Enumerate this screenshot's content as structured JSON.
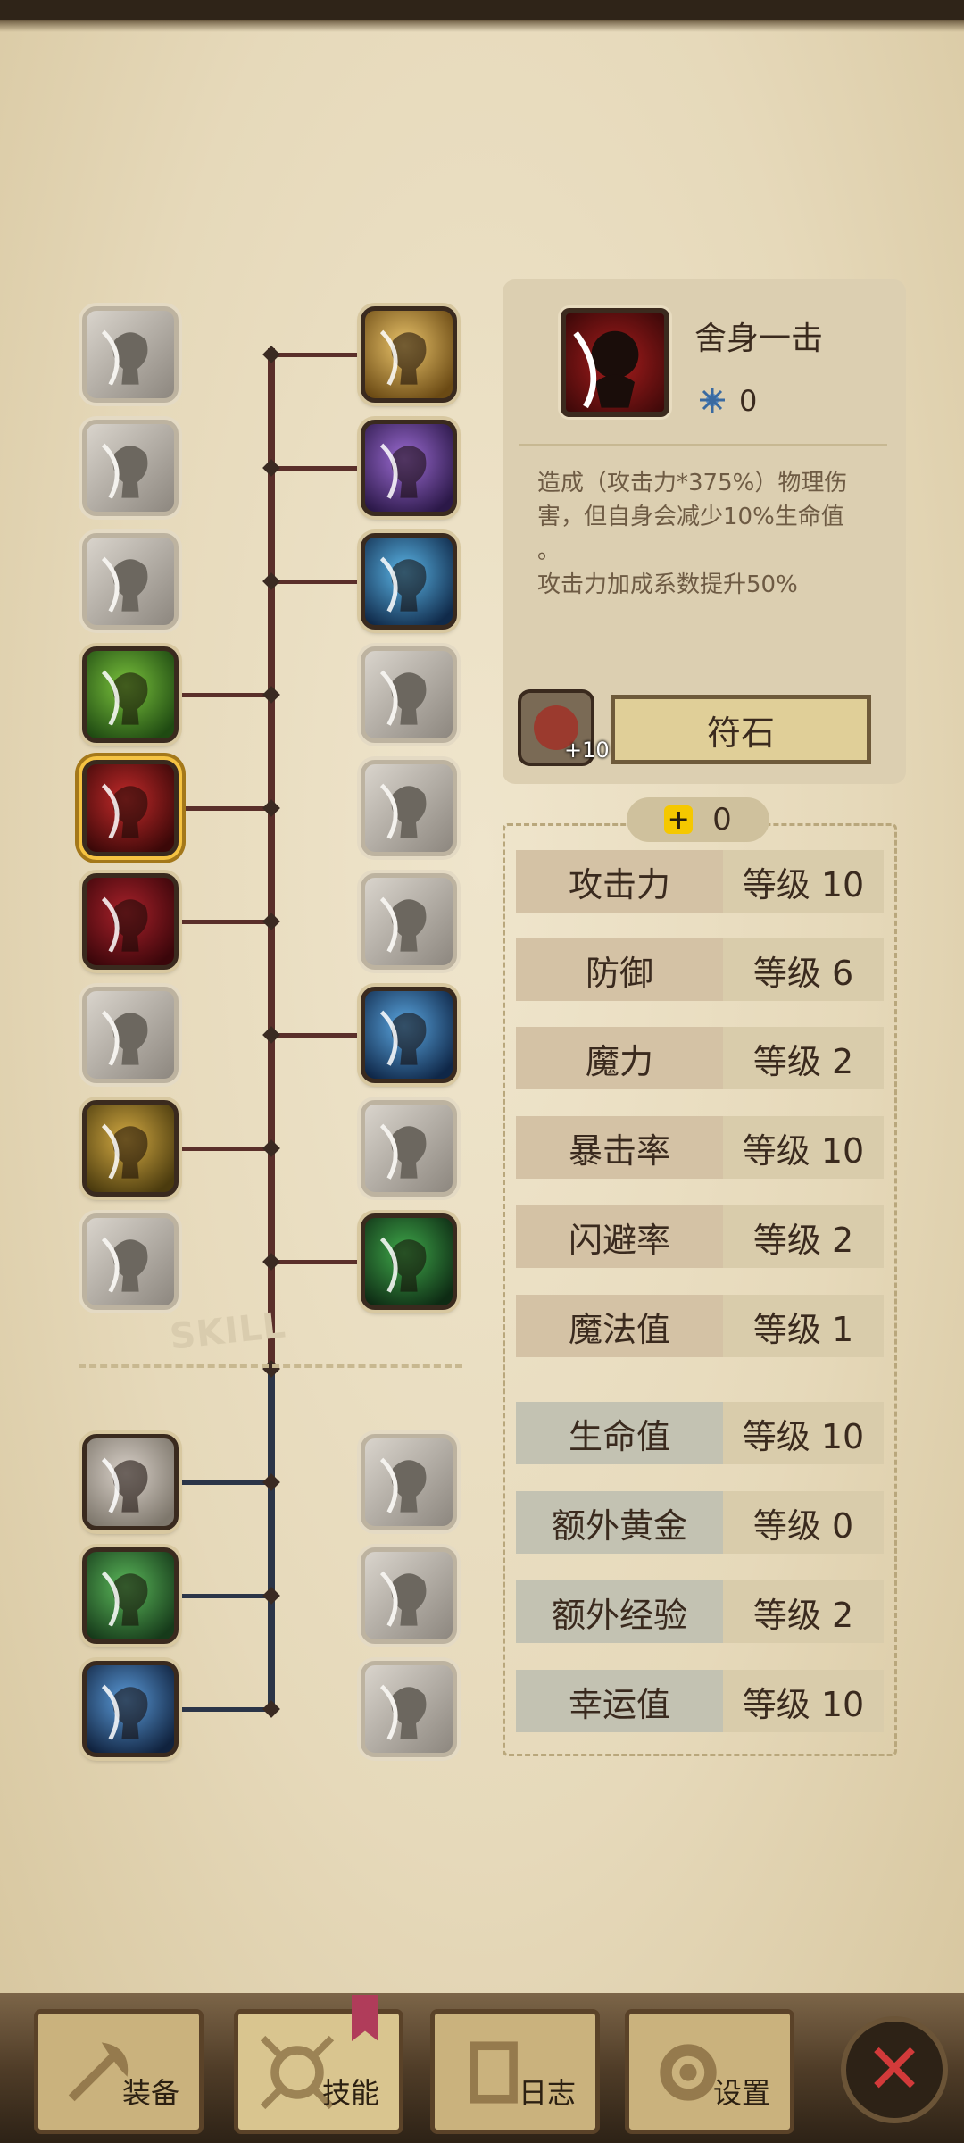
{
  "skill_tree": {
    "section_label": "SKILL",
    "left_skills": [
      {
        "id": "skill-slash",
        "state": "locked",
        "icon": "slash-icon"
      },
      {
        "id": "skill-kick",
        "state": "locked",
        "icon": "kick-icon"
      },
      {
        "id": "skill-roar",
        "state": "locked",
        "icon": "roar-icon"
      },
      {
        "id": "skill-muscle",
        "state": "unlocked",
        "icon": "muscle-arm-icon"
      },
      {
        "id": "skill-sacrifice-strike",
        "state": "selected",
        "icon": "sacrifice-strike-icon"
      },
      {
        "id": "skill-dagger",
        "state": "unlocked",
        "icon": "dagger-icon"
      },
      {
        "id": "skill-dash",
        "state": "locked",
        "icon": "dash-icon"
      },
      {
        "id": "skill-golden-fury",
        "state": "unlocked",
        "icon": "golden-fury-icon"
      },
      {
        "id": "skill-crossed-swords",
        "state": "locked",
        "icon": "crossed-swords-icon"
      }
    ],
    "right_skills": [
      {
        "id": "skill-holy-shield",
        "state": "unlocked",
        "icon": "holy-shield-icon"
      },
      {
        "id": "skill-shadow-ghost",
        "state": "unlocked",
        "icon": "shadow-ghost-icon"
      },
      {
        "id": "skill-lightning",
        "state": "unlocked",
        "icon": "lightning-icon"
      },
      {
        "id": "skill-run",
        "state": "locked",
        "icon": "run-icon"
      },
      {
        "id": "skill-smoke",
        "state": "locked",
        "icon": "smoke-icon"
      },
      {
        "id": "skill-eye",
        "state": "locked",
        "icon": "eye-blast-icon"
      },
      {
        "id": "skill-wind-blade",
        "state": "unlocked",
        "icon": "wind-blade-icon"
      },
      {
        "id": "skill-gear",
        "state": "locked",
        "icon": "gear-burst-icon"
      },
      {
        "id": "skill-clover",
        "state": "unlocked",
        "icon": "clover-ghost-icon"
      }
    ],
    "bonus_left": [
      {
        "id": "bonus-treasure-down",
        "state": "unlocked",
        "icon": "treasure-chest-down-icon"
      },
      {
        "id": "bonus-treasure-hand",
        "state": "unlocked",
        "icon": "treasure-hand-icon"
      },
      {
        "id": "bonus-blessing",
        "state": "unlocked",
        "icon": "blessing-figure-icon"
      }
    ],
    "bonus_right": [
      {
        "id": "bonus-eye-chest",
        "state": "locked",
        "icon": "eye-chest-icon"
      },
      {
        "id": "bonus-eye-box",
        "state": "locked",
        "icon": "eye-box-icon"
      },
      {
        "id": "bonus-mystery",
        "state": "locked",
        "icon": "mystery-figure-icon"
      }
    ]
  },
  "detail": {
    "skill_name": "舍身一击",
    "gem_count": "0",
    "description_lines": [
      "造成（攻击力*375%）物理伤",
      "害，但自身会减少10%生命值",
      "。",
      "攻击力加成系数提升50%"
    ],
    "rune_plus": "+10",
    "rune_button_label": "符石"
  },
  "stats": {
    "points": "0",
    "rows": [
      {
        "name": "攻击力",
        "level": "等级 10",
        "tone": "warm"
      },
      {
        "name": "防御",
        "level": "等级 6",
        "tone": "warm"
      },
      {
        "name": "魔力",
        "level": "等级 2",
        "tone": "warm"
      },
      {
        "name": "暴击率",
        "level": "等级 10",
        "tone": "warm"
      },
      {
        "name": "闪避率",
        "level": "等级 2",
        "tone": "warm"
      },
      {
        "name": "魔法值",
        "level": "等级 1",
        "tone": "warm"
      },
      {
        "name": "生命值",
        "level": "等级 10",
        "tone": "cool"
      },
      {
        "name": "额外黄金",
        "level": "等级 0",
        "tone": "cool"
      },
      {
        "name": "额外经验",
        "level": "等级 2",
        "tone": "cool"
      },
      {
        "name": "幸运值",
        "level": "等级 10",
        "tone": "cool"
      }
    ]
  },
  "nav": {
    "equipment": "装备",
    "skills": "技能",
    "log": "日志",
    "settings": "设置"
  },
  "colors": {
    "accent_gold": "#f5c342",
    "close_red": "#d23a3a",
    "parchment": "#e8dcc0"
  }
}
